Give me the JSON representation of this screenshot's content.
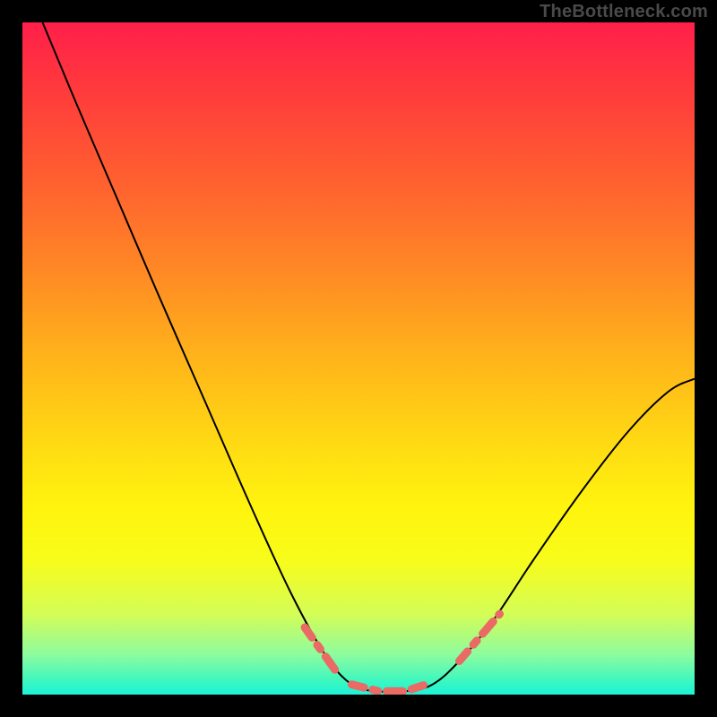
{
  "attribution": "TheBottleneck.com",
  "chart_data": {
    "type": "line",
    "title": "",
    "xlabel": "",
    "ylabel": "",
    "xlim": [
      0,
      100
    ],
    "ylim": [
      0,
      100
    ],
    "series": [
      {
        "name": "bottleneck-curve",
        "color": "#000000",
        "points": [
          {
            "x": 3,
            "y": 100
          },
          {
            "x": 8,
            "y": 88
          },
          {
            "x": 14,
            "y": 74
          },
          {
            "x": 20,
            "y": 60
          },
          {
            "x": 27,
            "y": 44
          },
          {
            "x": 34,
            "y": 28
          },
          {
            "x": 40,
            "y": 15
          },
          {
            "x": 45,
            "y": 6
          },
          {
            "x": 49,
            "y": 1.5
          },
          {
            "x": 53,
            "y": 0.5
          },
          {
            "x": 57,
            "y": 0.5
          },
          {
            "x": 61,
            "y": 1.5
          },
          {
            "x": 65,
            "y": 5
          },
          {
            "x": 70,
            "y": 11
          },
          {
            "x": 76,
            "y": 20
          },
          {
            "x": 83,
            "y": 30
          },
          {
            "x": 90,
            "y": 39
          },
          {
            "x": 96,
            "y": 45
          },
          {
            "x": 100,
            "y": 47
          }
        ]
      },
      {
        "name": "highlight-left-slope",
        "color": "#ea6a66",
        "points": [
          {
            "x": 42,
            "y": 10
          },
          {
            "x": 47,
            "y": 3
          }
        ]
      },
      {
        "name": "highlight-valley",
        "color": "#ea6a66",
        "points": [
          {
            "x": 49,
            "y": 1.5
          },
          {
            "x": 53,
            "y": 0.5
          },
          {
            "x": 57,
            "y": 0.5
          },
          {
            "x": 60,
            "y": 1.5
          }
        ]
      },
      {
        "name": "highlight-right-slope",
        "color": "#ea6a66",
        "points": [
          {
            "x": 65,
            "y": 5
          },
          {
            "x": 71,
            "y": 12
          }
        ]
      }
    ],
    "gradient_stops": [
      {
        "pos": 0,
        "color": "#ff1f4a"
      },
      {
        "pos": 50,
        "color": "#ffb41a"
      },
      {
        "pos": 80,
        "color": "#f8fc1a"
      },
      {
        "pos": 100,
        "color": "#1cf3d8"
      }
    ]
  }
}
